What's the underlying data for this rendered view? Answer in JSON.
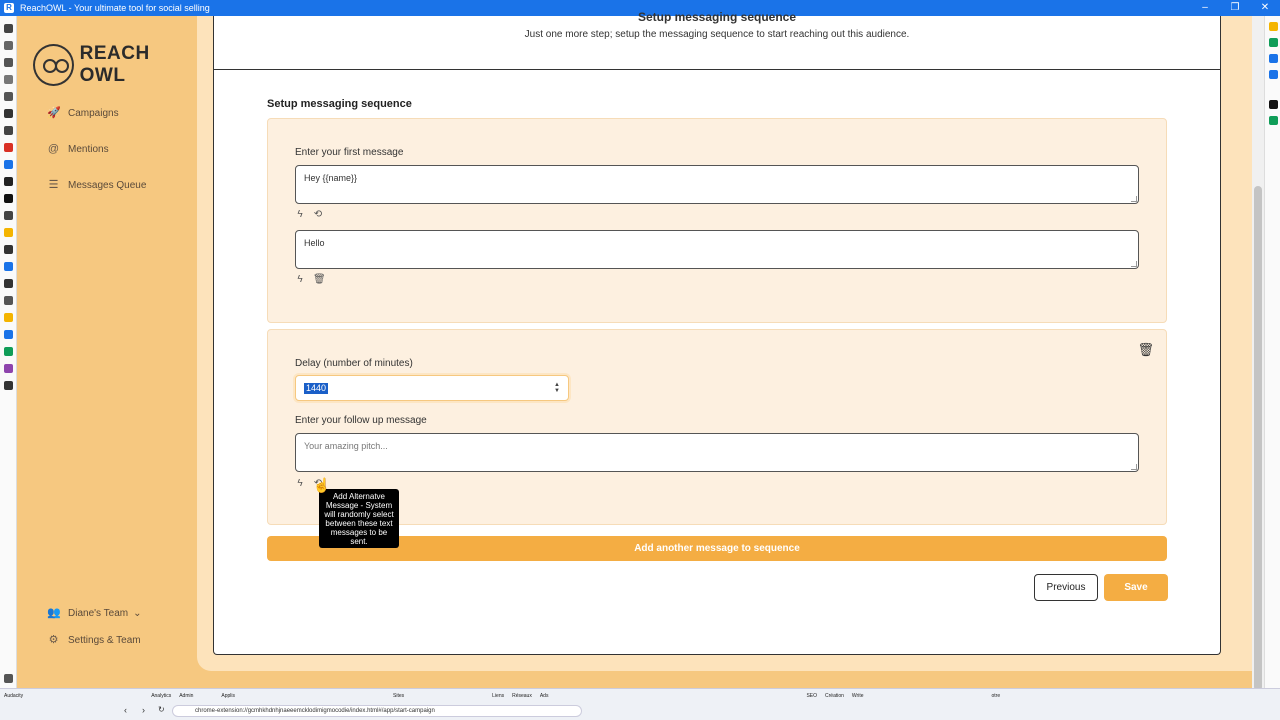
{
  "window": {
    "title": "ReachOWL - Your ultimate tool for social selling",
    "app_icon": "R"
  },
  "sidebar": {
    "logo_text": "REACH OWL",
    "items": [
      {
        "label": "Campaigns",
        "icon": "rocket-icon",
        "glyph": "🚀"
      },
      {
        "label": "Mentions",
        "icon": "at-icon",
        "glyph": "@"
      },
      {
        "label": "Messages Queue",
        "icon": "list-icon",
        "glyph": "☰"
      }
    ],
    "team": {
      "label": "Diane's Team",
      "chevron": "⌄"
    },
    "settings": {
      "label": "Settings & Team",
      "glyph": "⚙"
    }
  },
  "header": {
    "title": "Setup messaging sequence",
    "subtitle": "Just one more step; setup the messaging sequence to start reaching out this audience."
  },
  "section_title": "Setup messaging sequence",
  "first_message": {
    "label": "Enter your first message",
    "value": "Hey {{name}}",
    "alt_value": "Hello"
  },
  "follow_up": {
    "delay_label": "Delay (number of minutes)",
    "delay_value": "1440",
    "message_label": "Enter your follow up message",
    "message_placeholder": "Your amazing pitch..."
  },
  "tooltip": "Add Alternatve Message - System will randomly select between these text messages to be sent.",
  "buttons": {
    "add_message": "Add another message to sequence",
    "previous": "Previous",
    "save": "Save"
  },
  "icons": {
    "lightning": "ϟ",
    "repeat": "⟲",
    "trash": "🗑"
  },
  "browser": {
    "url": "chrome-extension://gcmhkhdnhjnaeeemcklodimigmocodie/index.html#/app/start-campaign",
    "taskbar": [
      "Audacity",
      "Analytics",
      "Admin",
      "Applis",
      "Sites",
      "Liens",
      "Réseaux",
      "Ads",
      "SEO",
      "Création",
      "Write",
      "otre"
    ]
  },
  "colors": {
    "accent": "#f4ad43",
    "sidebar": "#f6c880",
    "panel": "#fdf0e0"
  }
}
